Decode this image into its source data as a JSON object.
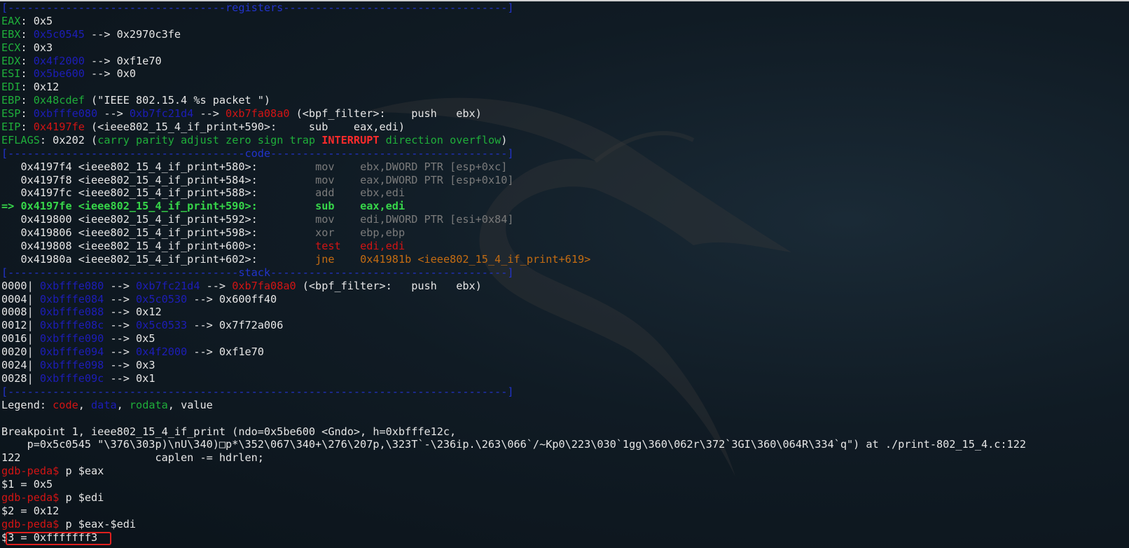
{
  "registers_header": "[----------------------------------registers-----------------------------------]",
  "registers": [
    {
      "name": "EAX",
      "value": "0x5",
      "chain": ""
    },
    {
      "name": "EBX",
      "value": "0x5c0545",
      "chain": " --> 0x2970c3fe"
    },
    {
      "name": "ECX",
      "value": "0x3",
      "chain": ""
    },
    {
      "name": "EDX",
      "value": "0x4f2000",
      "chain": " --> 0xf1e70"
    },
    {
      "name": "ESI",
      "value": "0x5be600",
      "chain": " --> 0x0"
    },
    {
      "name": "EDI",
      "value": "0x12",
      "chain": ""
    }
  ],
  "ebp": {
    "name": "EBP",
    "value": "0x48cdef",
    "rest": " (\"IEEE 802.15.4 %s packet \")"
  },
  "esp": {
    "name": "ESP",
    "value": "0xbfffe080",
    "arrow1": " --> ",
    "ptr1": "0xb7fc21d4",
    "arrow2": " --> ",
    "ptr2": "0xb7fa08a0",
    "rest": " (<bpf_filter>:    push   ebx)"
  },
  "eip": {
    "name": "EIP",
    "value": "0x4197fe",
    "rest": " (<ieee802_15_4_if_print+590>:     sub    eax,edi)"
  },
  "eflags": {
    "name": "EFLAGS",
    "value": "0x202",
    "open": " (",
    "flags_before": "carry parity adjust zero sign trap ",
    "interrupt": "INTERRUPT",
    "flags_after": " direction overflow",
    "close": ")"
  },
  "code_header": "[-------------------------------------code-------------------------------------]",
  "code": [
    {
      "prefix": "   ",
      "addr": "0x4197f4 <ieee802_15_4_if_print+580>:",
      "op": "mov ",
      "args": "ebx,DWORD PTR [esp+0xc]"
    },
    {
      "prefix": "   ",
      "addr": "0x4197f8 <ieee802_15_4_if_print+584>:",
      "op": "mov ",
      "args": "eax,DWORD PTR [esp+0x10]"
    },
    {
      "prefix": "   ",
      "addr": "0x4197fc <ieee802_15_4_if_print+588>:",
      "op": "add ",
      "args": "ebx,edi"
    },
    {
      "prefix": "=> ",
      "addr": "0x4197fe <ieee802_15_4_if_print+590>:",
      "op": "sub ",
      "args": "eax,edi"
    },
    {
      "prefix": "   ",
      "addr": "0x419800 <ieee802_15_4_if_print+592>:",
      "op": "mov ",
      "args": "edi,DWORD PTR [esi+0x84]"
    },
    {
      "prefix": "   ",
      "addr": "0x419806 <ieee802_15_4_if_print+598>:",
      "op": "xor ",
      "args": "ebp,ebp"
    },
    {
      "prefix": "   ",
      "addr": "0x419808 <ieee802_15_4_if_print+600>:",
      "op": "test",
      "args": "edi,edi"
    },
    {
      "prefix": "   ",
      "addr": "0x41980a <ieee802_15_4_if_print+602>:",
      "op": "jne ",
      "args": "0x41981b <ieee802_15_4_if_print+619>"
    }
  ],
  "stack_header": "[------------------------------------stack-------------------------------------]",
  "stack": [
    {
      "off": "0000|",
      "addr": "0xbfffe080",
      "p1": "0xb7fc21d4",
      "p1color": "blu",
      "p2": "0xb7fa08a0",
      "p2color": "red",
      "rest": " (<bpf_filter>:   push   ebx)"
    },
    {
      "off": "0004|",
      "addr": "0xbfffe084",
      "p1": "0x5c0530",
      "p1color": "blu",
      "p2": "0x600ff40",
      "p2color": "",
      "rest": ""
    },
    {
      "off": "0008|",
      "addr": "0xbfffe088",
      "p1": "0x12",
      "p1color": "",
      "p2": "",
      "p2color": "",
      "rest": ""
    },
    {
      "off": "0012|",
      "addr": "0xbfffe08c",
      "p1": "0x5c0533",
      "p1color": "blu",
      "p2": "0x7f72a006",
      "p2color": "",
      "rest": ""
    },
    {
      "off": "0016|",
      "addr": "0xbfffe090",
      "p1": "0x5",
      "p1color": "",
      "p2": "",
      "p2color": "",
      "rest": ""
    },
    {
      "off": "0020|",
      "addr": "0xbfffe094",
      "p1": "0x4f2000",
      "p1color": "blu",
      "p2": "0xf1e70",
      "p2color": "",
      "rest": ""
    },
    {
      "off": "0024|",
      "addr": "0xbfffe098",
      "p1": "0x3",
      "p1color": "",
      "p2": "",
      "p2color": "",
      "rest": ""
    },
    {
      "off": "0028|",
      "addr": "0xbfffe09c",
      "p1": "0x1",
      "p1color": "",
      "p2": "",
      "p2color": "",
      "rest": ""
    }
  ],
  "end_header": "[------------------------------------------------------------------------------]",
  "legend": {
    "label": "Legend: ",
    "code": "code",
    "data": "data",
    "rodata": "rodata",
    "value": "value",
    "sep": ", "
  },
  "breakpoint": {
    "line1": "Breakpoint 1, ieee802_15_4_if_print (ndo=0x5be600 <Gndo>, h=0xbfffe12c, ",
    "line2": "    p=0x5c0545 \"\\376\\303p)\\nU\\340)□p*\\352\\067\\340+\\276\\207p,\\323T`-\\236ip.\\263\\066`/~Kp0\\223\\030`1gg\\360\\062r\\372`3GI\\360\\064R\\334`q\") at ./print-802_15_4.c:122",
    "line3": "122                     caplen -= hdrlen;"
  },
  "prompt": "gdb-peda$ ",
  "commands": [
    {
      "cmd": "p $eax",
      "result": "$1 = 0x5"
    },
    {
      "cmd": "p $edi",
      "result": "$2 = 0x12"
    },
    {
      "cmd": "p $eax-$edi",
      "result": "$3 = 0xfffffff3"
    }
  ]
}
